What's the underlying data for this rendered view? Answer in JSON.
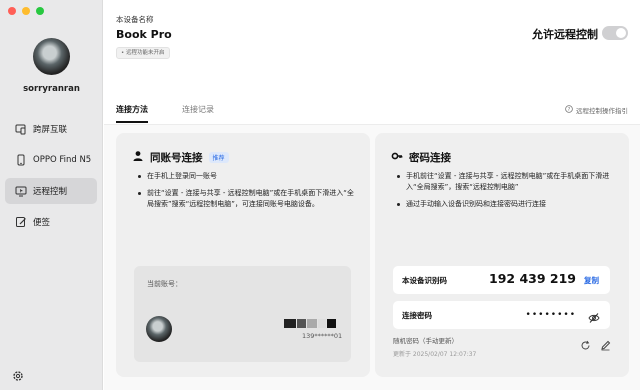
{
  "sidebar": {
    "username": "sorryranran",
    "items": [
      {
        "label": "跨屏互联",
        "icon": "cross-screen-icon",
        "active": false
      },
      {
        "label": "OPPO Find N5",
        "icon": "phone-icon",
        "active": false
      },
      {
        "label": "远程控制",
        "icon": "remote-control-icon",
        "active": true
      },
      {
        "label": "便签",
        "icon": "note-icon",
        "active": false
      }
    ],
    "settings_icon": "settings-icon"
  },
  "header": {
    "device_caption": "本设备名称",
    "device_name": "Book Pro",
    "remote_badge": "• 远程功能未开启",
    "allow_label": "允许远程控制",
    "allow_enabled": false
  },
  "tabs": {
    "items": [
      {
        "label": "连接方法",
        "active": true
      },
      {
        "label": "连接记录",
        "active": false
      }
    ],
    "guide_label": "远程控制操作指引"
  },
  "same_account": {
    "title": "同账号连接",
    "badge": "推荐",
    "bullets": [
      "在手机上登录同一账号",
      "前往“设置 - 连接与共享 - 远程控制电脑”或在手机桌面下滑进入“全局搜索”搜索“远程控制电脑”，可连接同账号电脑设备。"
    ],
    "account_caption": "当前账号：",
    "phone_masked": "139******01"
  },
  "password": {
    "title": "密码连接",
    "bullets": [
      "手机前往“设置 - 连接与共享 - 远程控制电脑”或在手机桌面下滑进入“全局搜索”，搜索“远程控制电脑”",
      "通过手动输入设备识别码和连接密码进行连接"
    ],
    "id_label": "本设备识别码",
    "id_value": "192 439 219",
    "copy_label": "复制",
    "pw_label": "连接密码",
    "pw_value": "••••••••",
    "random_label": "随机密码（手动更新）",
    "updated_label": "更新于 2025/02/07 12:07:37"
  },
  "colors": {
    "accent": "#2b6be4",
    "sidebar_bg": "#e9e9ea",
    "panel_bg": "#efefef"
  }
}
